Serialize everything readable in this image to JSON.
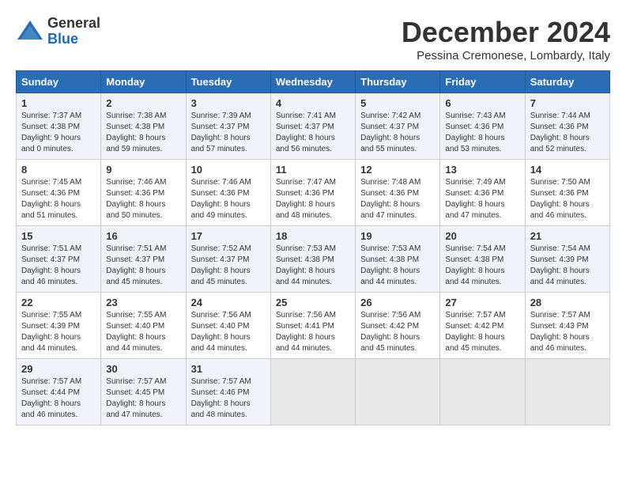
{
  "logo": {
    "general": "General",
    "blue": "Blue"
  },
  "title": {
    "month": "December 2024",
    "location": "Pessina Cremonese, Lombardy, Italy"
  },
  "days_of_week": [
    "Sunday",
    "Monday",
    "Tuesday",
    "Wednesday",
    "Thursday",
    "Friday",
    "Saturday"
  ],
  "weeks": [
    [
      {
        "day": "1",
        "sunrise": "Sunrise: 7:37 AM",
        "sunset": "Sunset: 4:38 PM",
        "daylight": "Daylight: 9 hours and 0 minutes."
      },
      {
        "day": "2",
        "sunrise": "Sunrise: 7:38 AM",
        "sunset": "Sunset: 4:38 PM",
        "daylight": "Daylight: 8 hours and 59 minutes."
      },
      {
        "day": "3",
        "sunrise": "Sunrise: 7:39 AM",
        "sunset": "Sunset: 4:37 PM",
        "daylight": "Daylight: 8 hours and 57 minutes."
      },
      {
        "day": "4",
        "sunrise": "Sunrise: 7:41 AM",
        "sunset": "Sunset: 4:37 PM",
        "daylight": "Daylight: 8 hours and 56 minutes."
      },
      {
        "day": "5",
        "sunrise": "Sunrise: 7:42 AM",
        "sunset": "Sunset: 4:37 PM",
        "daylight": "Daylight: 8 hours and 55 minutes."
      },
      {
        "day": "6",
        "sunrise": "Sunrise: 7:43 AM",
        "sunset": "Sunset: 4:36 PM",
        "daylight": "Daylight: 8 hours and 53 minutes."
      },
      {
        "day": "7",
        "sunrise": "Sunrise: 7:44 AM",
        "sunset": "Sunset: 4:36 PM",
        "daylight": "Daylight: 8 hours and 52 minutes."
      }
    ],
    [
      {
        "day": "8",
        "sunrise": "Sunrise: 7:45 AM",
        "sunset": "Sunset: 4:36 PM",
        "daylight": "Daylight: 8 hours and 51 minutes."
      },
      {
        "day": "9",
        "sunrise": "Sunrise: 7:46 AM",
        "sunset": "Sunset: 4:36 PM",
        "daylight": "Daylight: 8 hours and 50 minutes."
      },
      {
        "day": "10",
        "sunrise": "Sunrise: 7:46 AM",
        "sunset": "Sunset: 4:36 PM",
        "daylight": "Daylight: 8 hours and 49 minutes."
      },
      {
        "day": "11",
        "sunrise": "Sunrise: 7:47 AM",
        "sunset": "Sunset: 4:36 PM",
        "daylight": "Daylight: 8 hours and 48 minutes."
      },
      {
        "day": "12",
        "sunrise": "Sunrise: 7:48 AM",
        "sunset": "Sunset: 4:36 PM",
        "daylight": "Daylight: 8 hours and 47 minutes."
      },
      {
        "day": "13",
        "sunrise": "Sunrise: 7:49 AM",
        "sunset": "Sunset: 4:36 PM",
        "daylight": "Daylight: 8 hours and 47 minutes."
      },
      {
        "day": "14",
        "sunrise": "Sunrise: 7:50 AM",
        "sunset": "Sunset: 4:36 PM",
        "daylight": "Daylight: 8 hours and 46 minutes."
      }
    ],
    [
      {
        "day": "15",
        "sunrise": "Sunrise: 7:51 AM",
        "sunset": "Sunset: 4:37 PM",
        "daylight": "Daylight: 8 hours and 46 minutes."
      },
      {
        "day": "16",
        "sunrise": "Sunrise: 7:51 AM",
        "sunset": "Sunset: 4:37 PM",
        "daylight": "Daylight: 8 hours and 45 minutes."
      },
      {
        "day": "17",
        "sunrise": "Sunrise: 7:52 AM",
        "sunset": "Sunset: 4:37 PM",
        "daylight": "Daylight: 8 hours and 45 minutes."
      },
      {
        "day": "18",
        "sunrise": "Sunrise: 7:53 AM",
        "sunset": "Sunset: 4:38 PM",
        "daylight": "Daylight: 8 hours and 44 minutes."
      },
      {
        "day": "19",
        "sunrise": "Sunrise: 7:53 AM",
        "sunset": "Sunset: 4:38 PM",
        "daylight": "Daylight: 8 hours and 44 minutes."
      },
      {
        "day": "20",
        "sunrise": "Sunrise: 7:54 AM",
        "sunset": "Sunset: 4:38 PM",
        "daylight": "Daylight: 8 hours and 44 minutes."
      },
      {
        "day": "21",
        "sunrise": "Sunrise: 7:54 AM",
        "sunset": "Sunset: 4:39 PM",
        "daylight": "Daylight: 8 hours and 44 minutes."
      }
    ],
    [
      {
        "day": "22",
        "sunrise": "Sunrise: 7:55 AM",
        "sunset": "Sunset: 4:39 PM",
        "daylight": "Daylight: 8 hours and 44 minutes."
      },
      {
        "day": "23",
        "sunrise": "Sunrise: 7:55 AM",
        "sunset": "Sunset: 4:40 PM",
        "daylight": "Daylight: 8 hours and 44 minutes."
      },
      {
        "day": "24",
        "sunrise": "Sunrise: 7:56 AM",
        "sunset": "Sunset: 4:40 PM",
        "daylight": "Daylight: 8 hours and 44 minutes."
      },
      {
        "day": "25",
        "sunrise": "Sunrise: 7:56 AM",
        "sunset": "Sunset: 4:41 PM",
        "daylight": "Daylight: 8 hours and 44 minutes."
      },
      {
        "day": "26",
        "sunrise": "Sunrise: 7:56 AM",
        "sunset": "Sunset: 4:42 PM",
        "daylight": "Daylight: 8 hours and 45 minutes."
      },
      {
        "day": "27",
        "sunrise": "Sunrise: 7:57 AM",
        "sunset": "Sunset: 4:42 PM",
        "daylight": "Daylight: 8 hours and 45 minutes."
      },
      {
        "day": "28",
        "sunrise": "Sunrise: 7:57 AM",
        "sunset": "Sunset: 4:43 PM",
        "daylight": "Daylight: 8 hours and 46 minutes."
      }
    ],
    [
      {
        "day": "29",
        "sunrise": "Sunrise: 7:57 AM",
        "sunset": "Sunset: 4:44 PM",
        "daylight": "Daylight: 8 hours and 46 minutes."
      },
      {
        "day": "30",
        "sunrise": "Sunrise: 7:57 AM",
        "sunset": "Sunset: 4:45 PM",
        "daylight": "Daylight: 8 hours and 47 minutes."
      },
      {
        "day": "31",
        "sunrise": "Sunrise: 7:57 AM",
        "sunset": "Sunset: 4:46 PM",
        "daylight": "Daylight: 8 hours and 48 minutes."
      },
      null,
      null,
      null,
      null
    ]
  ]
}
